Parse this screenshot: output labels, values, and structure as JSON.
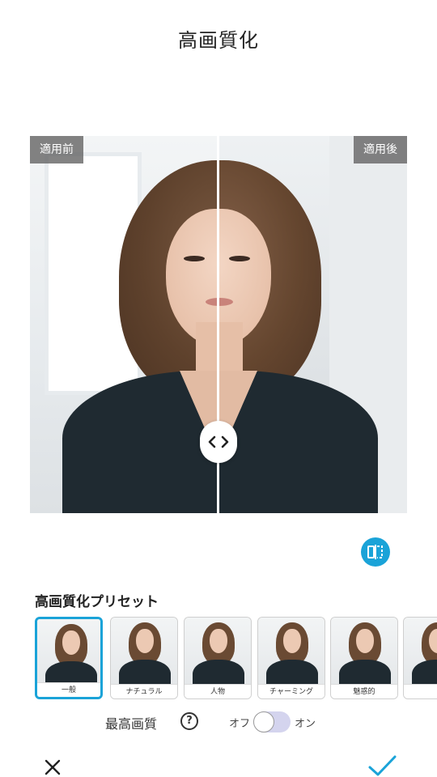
{
  "header": {
    "title": "高画質化"
  },
  "compare": {
    "before_label": "適用前",
    "after_label": "適用後",
    "handle_icon": "chevron-left-right-icon",
    "split_position_percent": 50
  },
  "compare_toggle": {
    "icon": "split-compare-icon",
    "color": "#1aa3d8"
  },
  "presets": {
    "heading": "高画質化プリセット",
    "selected_index": 0,
    "items": [
      {
        "label": "一般"
      },
      {
        "label": "ナチュラル"
      },
      {
        "label": "人物"
      },
      {
        "label": "チャーミング"
      },
      {
        "label": "魅惑的"
      },
      {
        "label": ""
      }
    ]
  },
  "quality": {
    "label": "最高画質",
    "help_icon": "question-circle-icon",
    "off_label": "オフ",
    "on_label": "オン",
    "enabled": false
  },
  "footer": {
    "cancel_icon": "close-icon",
    "confirm_icon": "checkmark-icon",
    "accent": "#1aa3d8"
  }
}
